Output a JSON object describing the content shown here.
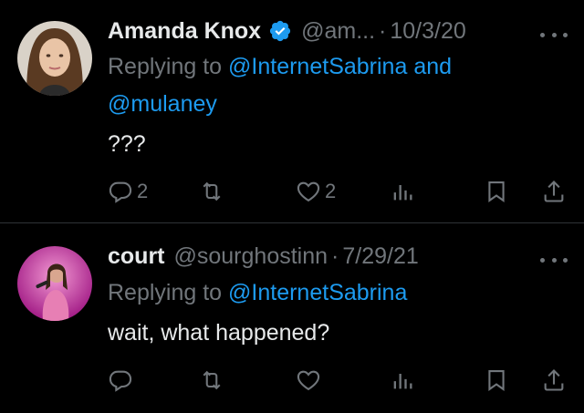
{
  "tweets": [
    {
      "name": "Amanda Knox",
      "verified": true,
      "handle": "@am...",
      "dot": "·",
      "date": "10/3/20",
      "replying_prefix": "Replying to",
      "mention1": "@InternetSabrina",
      "conj": "and",
      "mention2": "@mulaney",
      "text": "???",
      "reply_count": "2",
      "like_count": "2"
    },
    {
      "name": "court",
      "verified": false,
      "handle": "@sourghostinn",
      "dot": "·",
      "date": "7/29/21",
      "replying_prefix": "Replying to",
      "mention1": "@InternetSabrina",
      "text": "wait, what happened?"
    }
  ],
  "colors": {
    "accent": "#1d9bf0",
    "secondary": "#71767b",
    "text": "#e7e9ea",
    "background": "#000000"
  },
  "icons": [
    "reply-icon",
    "retweet-icon",
    "like-icon",
    "views-icon",
    "bookmark-icon",
    "share-icon",
    "more-icon",
    "verified-badge-icon"
  ]
}
